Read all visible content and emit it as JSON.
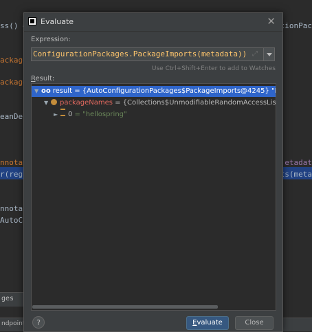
{
  "background_editor": {
    "left_lines": [
      {
        "text": "ss() =",
        "color": "#a9b7c6"
      },
      {
        "text": "ackage",
        "color": "#cc7832"
      },
      {
        "text": "ackage",
        "color": "#cc7832"
      },
      {
        "text": "eanDef",
        "color": "#a9b7c6"
      },
      {
        "text": "nnotat",
        "color": "#cc7832"
      },
      {
        "text": "r(regi",
        "color": "#a9b7c6"
      },
      {
        "text": "nnotat",
        "color": "#a9b7c6"
      },
      {
        "text": "AutoCo",
        "color": "#a9b7c6"
      }
    ],
    "right_lines": [
      {
        "text": "tionPac",
        "color": "#a9b7c6"
      },
      {
        "text": "etadat",
        "color": "#9876aa"
      },
      {
        "text": "ts(meta",
        "color": "#a9b7c6"
      }
    ],
    "bottom_tab": "ges",
    "status_text": "ndpoints"
  },
  "dialog": {
    "title": "Evaluate",
    "expression_label": "Expression:",
    "expression_value": "ConfigurationPackages.PackageImports(metadata))",
    "watch_hint": "Use Ctrl+Shift+Enter to add to Watches",
    "result_label": "Result:",
    "tree": [
      {
        "prefix": "oo",
        "name": "result",
        "value": " = {AutoConfigurationPackages$PackageImports@4245} \"Packa",
        "selected": true
      },
      {
        "prefix": "field",
        "name": "packageNames",
        "value": " = {Collections$UnmodifiableRandomAccessList@4",
        "selected": false
      },
      {
        "prefix": "elem",
        "name": "0",
        "value": " = \"hellospring\"",
        "selected": false
      }
    ],
    "evaluate_button": "Evaluate",
    "close_button": "Close",
    "help_label": "?"
  }
}
